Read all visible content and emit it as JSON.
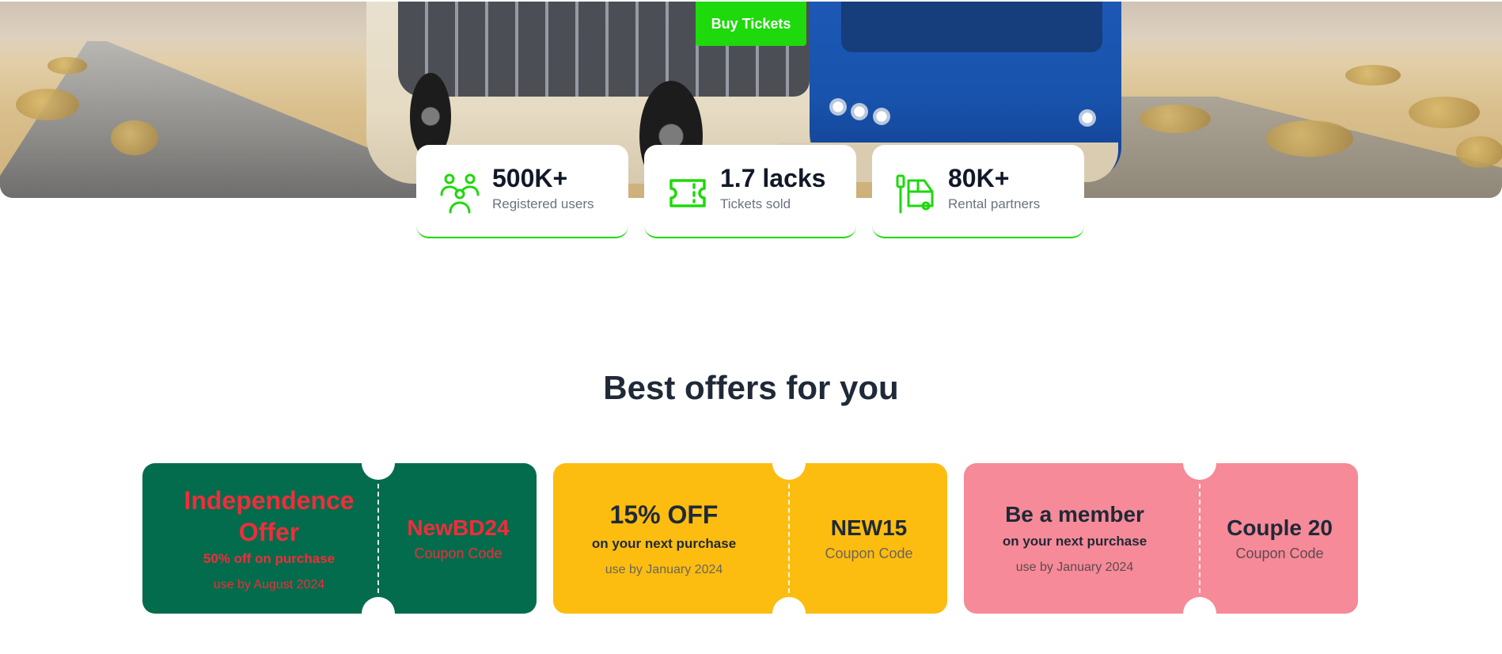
{
  "hero": {
    "buy_button_label": "Buy Tickets"
  },
  "stats": [
    {
      "value": "500K+",
      "label": "Registered users",
      "icon": "users-icon"
    },
    {
      "value": "1.7 lacks",
      "label": "Tickets sold",
      "icon": "ticket-icon"
    },
    {
      "value": "80K+",
      "label": "Rental partners",
      "icon": "bus-stop-icon"
    }
  ],
  "offers_section": {
    "title": "Best offers for you"
  },
  "coupons": [
    {
      "title": "Independence Offer",
      "subtitle": "50% off on purchase",
      "validity": "use by August 2024",
      "code": "NewBD24",
      "code_label": "Coupon Code"
    },
    {
      "title": "15% OFF",
      "subtitle": "on your next purchase",
      "validity": "use by January 2024",
      "code": "NEW15",
      "code_label": "Coupon Code"
    },
    {
      "title": "Be a member",
      "subtitle": "on your next purchase",
      "validity": "use by January 2024",
      "code": "Couple 20",
      "code_label": "Coupon Code"
    }
  ],
  "colors": {
    "accent_green": "#1ed90b",
    "coupon_green": "#026c4c",
    "coupon_yellow": "#fdbd10",
    "coupon_pink": "#f68a98",
    "coupon_red_text": "#f02d3a",
    "heading_dark": "#1f2937"
  }
}
